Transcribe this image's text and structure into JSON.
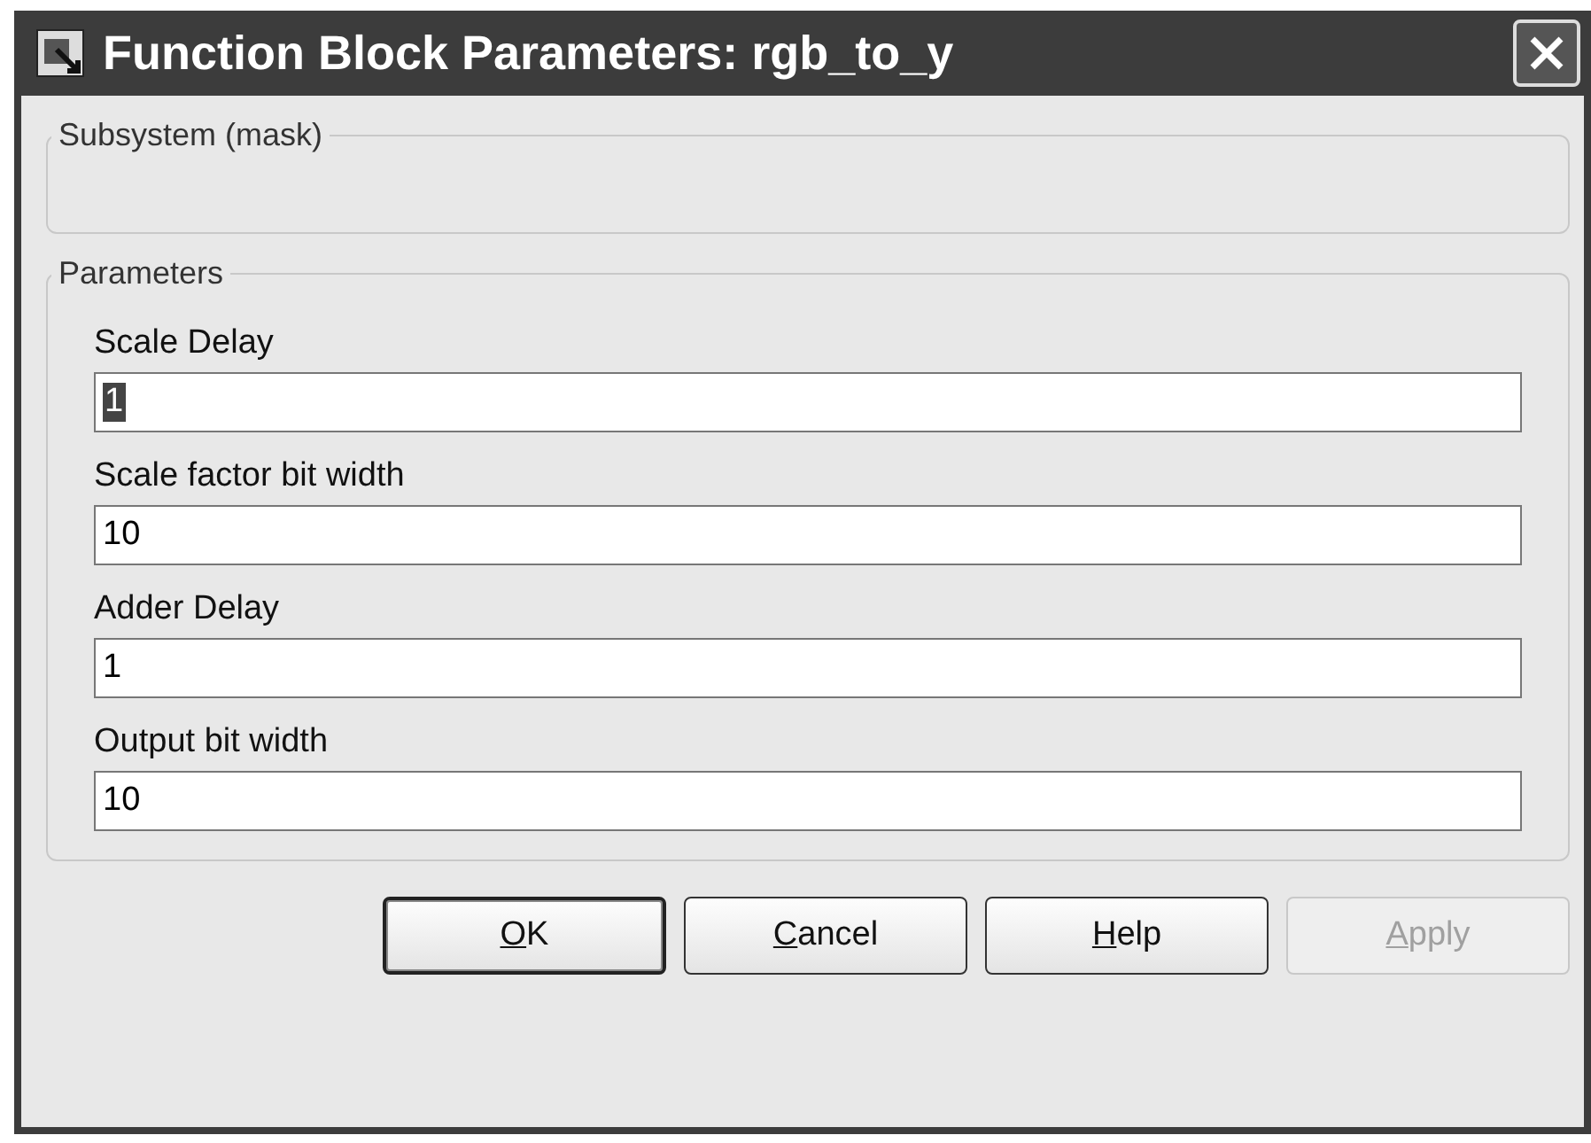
{
  "window": {
    "title": "Function Block Parameters: rgb_to_y"
  },
  "description_group": {
    "title": "Subsystem (mask)"
  },
  "parameters_group": {
    "title": "Parameters",
    "fields": [
      {
        "label": "Scale Delay",
        "value": "1",
        "highlighted": true
      },
      {
        "label": "Scale factor bit width",
        "value": "10",
        "highlighted": false
      },
      {
        "label": "Adder Delay",
        "value": "1",
        "highlighted": false
      },
      {
        "label": "Output bit width",
        "value": "10",
        "highlighted": false
      }
    ]
  },
  "buttons": [
    {
      "label": "OK",
      "disabled": false,
      "default": true
    },
    {
      "label": "Cancel",
      "disabled": false,
      "default": false
    },
    {
      "label": "Help",
      "disabled": false,
      "default": false
    },
    {
      "label": "Apply",
      "disabled": true,
      "default": false
    }
  ]
}
